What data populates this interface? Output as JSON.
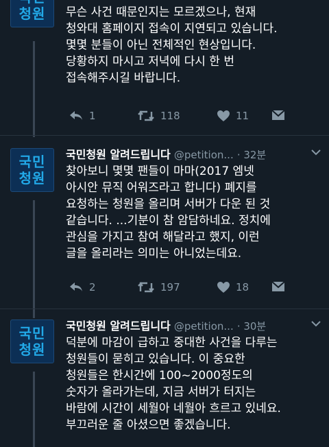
{
  "avatar": {
    "line1": "국민",
    "line2": "청원",
    "color": "#22a9e8"
  },
  "tweets": [
    {
      "body": "무슨 사건 때문인지는 모르겠으나, 현재\n청와대 홈페이지 접속이 지연되고 있습니다.\n몇몇 분들이 아닌 전체적인 현상입니다.\n당황하지 마시고 저녁에 다시 한 번\n접속해주시길 바랍니다.",
      "replies": "1",
      "retweets": "118",
      "likes": "11"
    },
    {
      "name": "국민청원 알려드립니다",
      "handle": "@petition...",
      "time": "· 32분",
      "body": "찾아보니 몇몇 팬들이 마마(2017 엠넷\n아시안 뮤직 어워즈라고 합니다) 폐지를\n요청하는 청원을 올리며 서버가 다운 된 것\n같습니다. ...기분이 참 암담하네요. 정치에\n관심을 가지고 참여 해달라고 했지, 이런\n글을 올리라는 의미는 아니었는데요.",
      "replies": "2",
      "retweets": "197",
      "likes": "18"
    },
    {
      "name": "국민청원 알려드립니다",
      "handle": "@petition...",
      "time": "· 30분",
      "body": "덕분에 마감이 급하고 중대한 사건을 다루는\n청원들이 묻히고 있습니다. 이 중요한\n청원들은 한시간에 100~2000정도의\n숫자가 올라가는데, 지금 서버가 터지는\n바람에 시간이 세월아 네월아 흐르고 있네요.\n부끄러운 줄 아셨으면 좋겠습니다."
    }
  ]
}
